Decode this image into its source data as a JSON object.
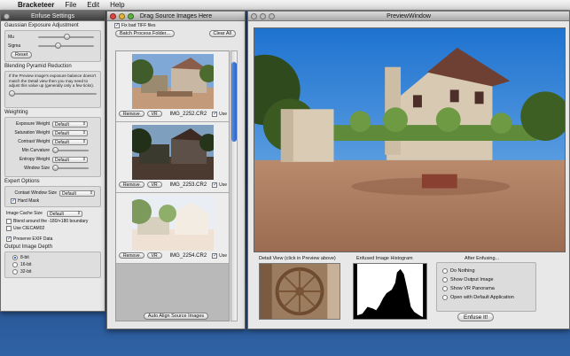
{
  "menubar": {
    "app": "Bracketeer",
    "items": [
      "File",
      "Edit",
      "Help"
    ]
  },
  "settings": {
    "title": "Enfuse Settings",
    "gaussian": {
      "title": "Gaussian Exposure Adjustment",
      "mu_label": "Mu",
      "mu_value": 0.5,
      "sigma_label": "Sigma",
      "sigma_value": 0.3,
      "reset_label": "Reset"
    },
    "blending": {
      "title": "Blending Pyramid Reduction",
      "text": "If the Preview image's exposure balance doesn't match the Detail view then you may need to adjust this value up (generally only a few ticks).",
      "value": 0.05
    },
    "weighting": {
      "title": "Weighting",
      "rows": [
        {
          "label": "Exposure Weight",
          "value": "Default"
        },
        {
          "label": "Saturation Weight",
          "value": "Default"
        },
        {
          "label": "Contrast Weight",
          "value": "Default"
        }
      ],
      "min_curvature_label": "Min Curvature",
      "min_curvature_value": 0.05,
      "entropy_label": "Entropy Weight",
      "entropy_value": "Default",
      "window_size_label": "Window Size",
      "window_size_value": 0.05
    },
    "expert": {
      "title": "Expert Options",
      "contrast_window_label": "Contast Window Size",
      "contrast_window_value": "Default",
      "hard_mask_label": "Hard Mask",
      "hard_mask_checked": true,
      "image_cache_label": "Image Cache Size",
      "image_cache_value": "Default",
      "blend_boundary_label": "Blend around the -180/+180 boundary",
      "use_ciecam_label": "Use CIECAM02"
    },
    "preserve_exif_label": "Preserve EXIF Data",
    "preserve_exif_checked": true,
    "depth": {
      "title": "Output Image Depth",
      "options": [
        "8-bit",
        "16-bit",
        "32-bit"
      ],
      "selected": "8-bit"
    }
  },
  "drag": {
    "title": "Drag Source Images Here",
    "fix_tiff_label": "Fix bad TIFF files",
    "batch_label": "Batch Process Folder...",
    "clear_label": "Clear All",
    "images": [
      {
        "name": "IMG_2252.CR2",
        "remove": "Remove",
        "vr": "VR",
        "use": "Use"
      },
      {
        "name": "IMG_2253.CR2",
        "remove": "Remove",
        "vr": "VR",
        "use": "Use"
      },
      {
        "name": "IMG_2254.CR2",
        "remove": "Remove",
        "vr": "VR",
        "use": "Use"
      }
    ],
    "auto_align_label": "Auto Align Source Images"
  },
  "preview": {
    "title": "PreviewWindow",
    "detail_label": "Detail View (click in Preview above)",
    "histogram_label": "Enfused Image Histogram",
    "after_label": "After Enfusing...",
    "after_options": [
      "Do Nothing",
      "Show Output Image",
      "Show VR Panorama",
      "Open with Default Application"
    ],
    "after_selected": "Do Nothing",
    "enfuse_label": "Enfuse It!"
  }
}
